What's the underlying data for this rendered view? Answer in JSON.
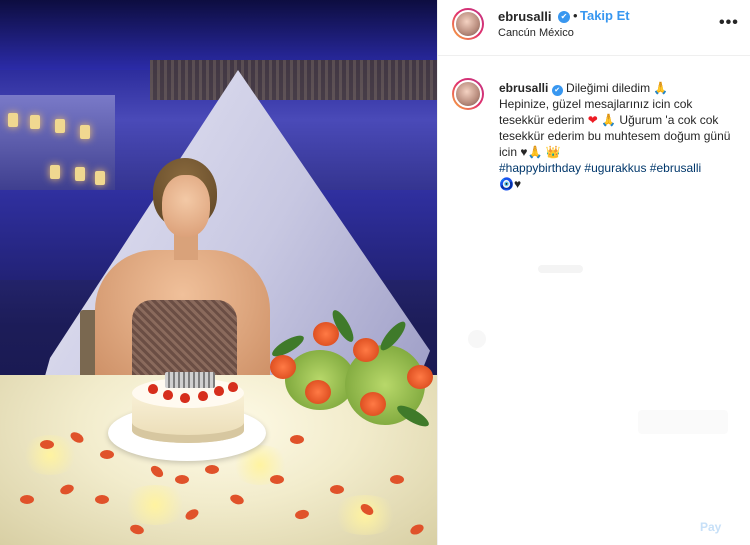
{
  "header": {
    "username": "ebrusalli",
    "verified_mark": "✔",
    "separator": "•",
    "follow_label": "Takip Et",
    "location": "Cancún México",
    "more_label": "•••"
  },
  "caption": {
    "username": "ebrusalli",
    "verified_mark": "✔",
    "line1": " Dileğimi diledim ",
    "line2": "Hepinize, güzel mesajlarınız icin cok tesekkür ederim ",
    "line3": " Uğurum 'a cok cok tesekkür ederim bu muhtesem doğum günü icin ",
    "heart_black": "♥",
    "hashtags": [
      "#happybirthday",
      "#ugurakkus",
      "#ebrusalli"
    ],
    "emoji_pray": "🙏",
    "emoji_heart": "❤",
    "emoji_crown": "👑",
    "emoji_eye": "🧿",
    "end_heart": "♥"
  },
  "comment": {
    "post_label": "Pay"
  },
  "colors": {
    "accent": "#3897f0",
    "text": "#262626",
    "hashtag": "#00376b",
    "heart": "#ed1c24"
  },
  "icons": [
    "verified-icon",
    "more-icon",
    "pray-emoji",
    "heart-emoji",
    "crown-emoji",
    "evil-eye-emoji"
  ]
}
